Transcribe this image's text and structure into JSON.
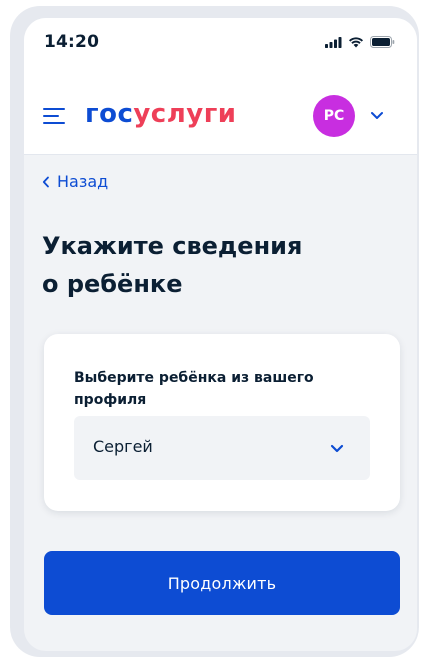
{
  "status_bar": {
    "time": "14:20",
    "icons": [
      "signal-icon",
      "wifi-icon",
      "battery-icon"
    ]
  },
  "header": {
    "logo_part1": "гос",
    "logo_part2": "услуги",
    "avatar_initials": "РС",
    "colors": {
      "logo_blue": "#0d4cd3",
      "logo_red": "#ee3f58",
      "avatar": "#c82ee0"
    }
  },
  "back_link": {
    "label": "Назад"
  },
  "page": {
    "title_line1": "Укажите сведения",
    "title_line2": "о ребёнке"
  },
  "form": {
    "field_label": "Выберите ребёнка из вашего профиля",
    "selected_value": "Сергей"
  },
  "actions": {
    "continue_label": "Продолжить",
    "primary_color": "#0d4cd3"
  }
}
